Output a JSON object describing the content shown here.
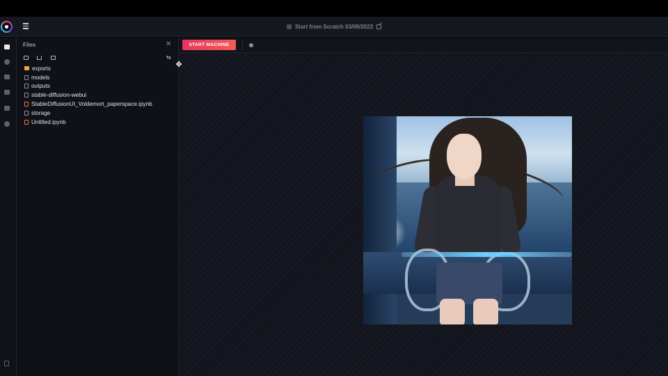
{
  "header": {
    "notebook_title": "Start from Scratch 03/09/2023",
    "icons": [
      "app-logo",
      "hamburger-menu-icon",
      "notebook-icon",
      "edit-icon"
    ]
  },
  "rail": {
    "icons": [
      "files-icon",
      "data-icon",
      "stack-icon",
      "notes-icon",
      "terminal-icon",
      "clock-icon",
      "docs-icon"
    ],
    "active": "files-icon"
  },
  "files_panel": {
    "title": "Files",
    "close_icon": "close-icon",
    "toolbar_icons": [
      "new-folder-icon",
      "upload-icon",
      "upload-folder-icon",
      "refresh-icon"
    ],
    "items": [
      {
        "name": "exports",
        "type": "folder"
      },
      {
        "name": "models",
        "type": "file"
      },
      {
        "name": "outputs",
        "type": "file"
      },
      {
        "name": "stable-diffusion-webui",
        "type": "file"
      },
      {
        "name": "StableDiffusionUI_Voldemort_paperspace.ipynb",
        "type": "notebook"
      },
      {
        "name": "storage",
        "type": "file"
      },
      {
        "name": "Untitled.ipynb",
        "type": "notebook"
      }
    ]
  },
  "toolbar": {
    "start_label": "START MACHINE",
    "status": "idle"
  },
  "colors": {
    "accent": "#e8345f",
    "background": "#12151d",
    "folder": "#f1a53a",
    "notebook": "#e4793d"
  }
}
